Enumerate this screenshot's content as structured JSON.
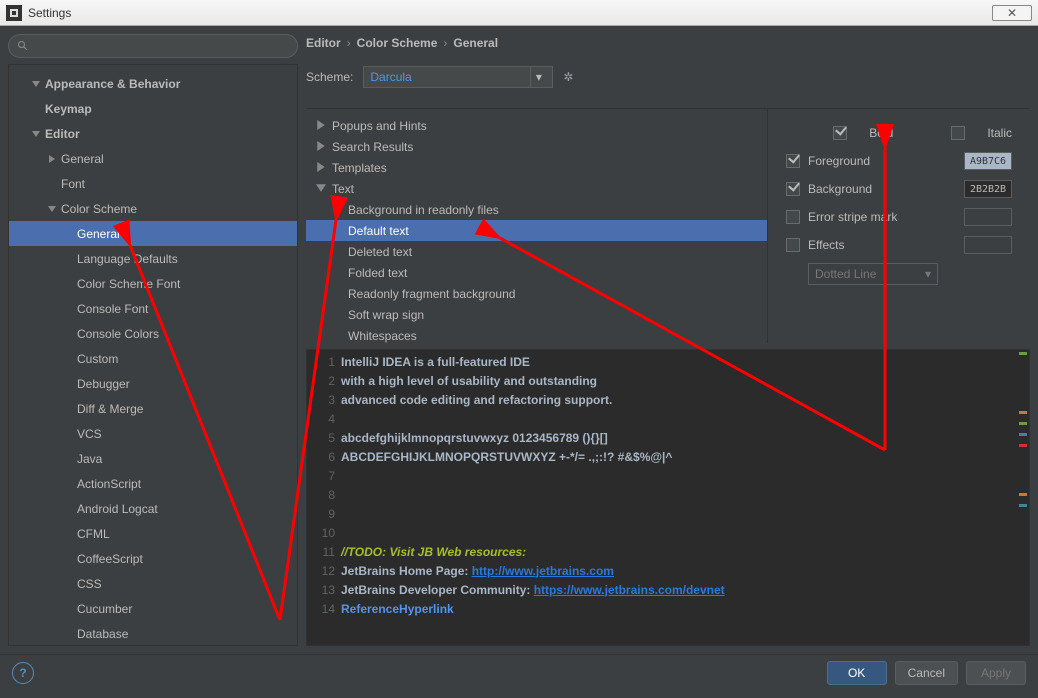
{
  "window": {
    "title": "Settings",
    "close": "✕"
  },
  "breadcrumb": {
    "a": "Editor",
    "b": "Color Scheme",
    "c": "General"
  },
  "scheme": {
    "label": "Scheme:",
    "value": "Darcula"
  },
  "tree": [
    {
      "label": "Appearance & Behavior",
      "indent": 0,
      "arrow": "down",
      "bold": true
    },
    {
      "label": "Keymap",
      "indent": 0,
      "arrow": "",
      "bold": true
    },
    {
      "label": "Editor",
      "indent": 0,
      "arrow": "down",
      "bold": true
    },
    {
      "label": "General",
      "indent": 1,
      "arrow": "right",
      "bold": false
    },
    {
      "label": "Font",
      "indent": 1,
      "arrow": "",
      "bold": false
    },
    {
      "label": "Color Scheme",
      "indent": 1,
      "arrow": "down",
      "bold": false
    },
    {
      "label": "General",
      "indent": 2,
      "arrow": "",
      "bold": false,
      "selected": true
    },
    {
      "label": "Language Defaults",
      "indent": 2,
      "arrow": "",
      "bold": false
    },
    {
      "label": "Color Scheme Font",
      "indent": 2,
      "arrow": "",
      "bold": false
    },
    {
      "label": "Console Font",
      "indent": 2,
      "arrow": "",
      "bold": false
    },
    {
      "label": "Console Colors",
      "indent": 2,
      "arrow": "",
      "bold": false
    },
    {
      "label": "Custom",
      "indent": 2,
      "arrow": "",
      "bold": false
    },
    {
      "label": "Debugger",
      "indent": 2,
      "arrow": "",
      "bold": false
    },
    {
      "label": "Diff & Merge",
      "indent": 2,
      "arrow": "",
      "bold": false
    },
    {
      "label": "VCS",
      "indent": 2,
      "arrow": "",
      "bold": false
    },
    {
      "label": "Java",
      "indent": 2,
      "arrow": "",
      "bold": false
    },
    {
      "label": "ActionScript",
      "indent": 2,
      "arrow": "",
      "bold": false
    },
    {
      "label": "Android Logcat",
      "indent": 2,
      "arrow": "",
      "bold": false
    },
    {
      "label": "CFML",
      "indent": 2,
      "arrow": "",
      "bold": false
    },
    {
      "label": "CoffeeScript",
      "indent": 2,
      "arrow": "",
      "bold": false
    },
    {
      "label": "CSS",
      "indent": 2,
      "arrow": "",
      "bold": false
    },
    {
      "label": "Cucumber",
      "indent": 2,
      "arrow": "",
      "bold": false
    },
    {
      "label": "Database",
      "indent": 2,
      "arrow": "",
      "bold": false
    }
  ],
  "categories": [
    {
      "label": "Popups and Hints",
      "arrow": "right"
    },
    {
      "label": "Search Results",
      "arrow": "right"
    },
    {
      "label": "Templates",
      "arrow": "right"
    },
    {
      "label": "Text",
      "arrow": "down"
    },
    {
      "label": "Background in readonly files",
      "sub": true
    },
    {
      "label": "Default text",
      "sub": true,
      "selected": true
    },
    {
      "label": "Deleted text",
      "sub": true
    },
    {
      "label": "Folded text",
      "sub": true
    },
    {
      "label": "Readonly fragment background",
      "sub": true
    },
    {
      "label": "Soft wrap sign",
      "sub": true
    },
    {
      "label": "Whitespaces",
      "sub": true
    }
  ],
  "opts": {
    "bold": "Bold",
    "italic": "Italic",
    "foreground": "Foreground",
    "background": "Background",
    "errorstripe": "Error stripe mark",
    "effects": "Effects",
    "effect_type": "Dotted Line",
    "fg_color": "A9B7C6",
    "bg_color": "2B2B2B"
  },
  "preview": {
    "lines": [
      {
        "n": "1",
        "text": "IntelliJ IDEA is a full-featured IDE"
      },
      {
        "n": "2",
        "text": "with a high level of usability and outstanding"
      },
      {
        "n": "3",
        "text": "advanced code editing and refactoring support."
      },
      {
        "n": "4",
        "text": ""
      },
      {
        "n": "5",
        "text": "abcdefghijklmnopqrstuvwxyz 0123456789 (){}[]"
      },
      {
        "n": "6",
        "text": "ABCDEFGHIJKLMNOPQRSTUVWXYZ +-*/= .,;:!? #&$%@|^"
      },
      {
        "n": "7",
        "text": ""
      },
      {
        "n": "8",
        "text": ""
      },
      {
        "n": "9",
        "text": ""
      },
      {
        "n": "10",
        "text": ""
      }
    ],
    "line11_n": "11",
    "line11_todo": "//TODO: Visit JB Web resources:",
    "line12_n": "12",
    "line12_pre": "JetBrains Home Page: ",
    "line12_link": "http://www.jetbrains.com",
    "line13_n": "13",
    "line13_pre": "JetBrains Developer Community: ",
    "line13_link": "https://www.jetbrains.com/devnet",
    "line14_n": "14",
    "line14_ref": "ReferenceHyperlink"
  },
  "footer": {
    "ok": "OK",
    "cancel": "Cancel",
    "apply": "Apply"
  }
}
